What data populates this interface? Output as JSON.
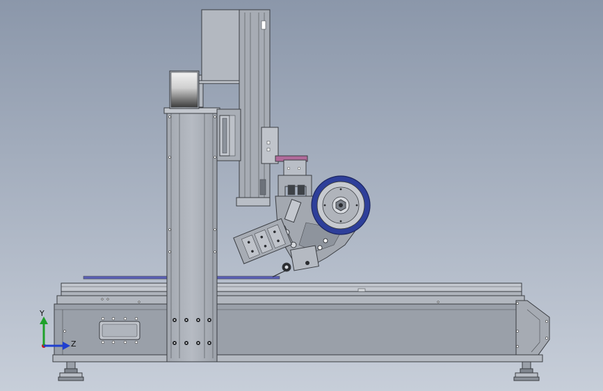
{
  "view": {
    "background_top": "#8b97aa",
    "background_bottom": "#c7ced9"
  },
  "axis_triad": {
    "y_label": "Y",
    "z_label": "Z",
    "y_color": "#1fa12a",
    "z_color": "#1f3fd0",
    "x_color": "#c8141e"
  },
  "colors": {
    "metal_light": "#b9bec6",
    "metal_mid": "#9aa0a9",
    "metal_dark": "#7c828b",
    "roller_blue": "#2e3f9a",
    "tape_magenta": "#b06a9a",
    "table_strip": "#5a5fb5"
  }
}
